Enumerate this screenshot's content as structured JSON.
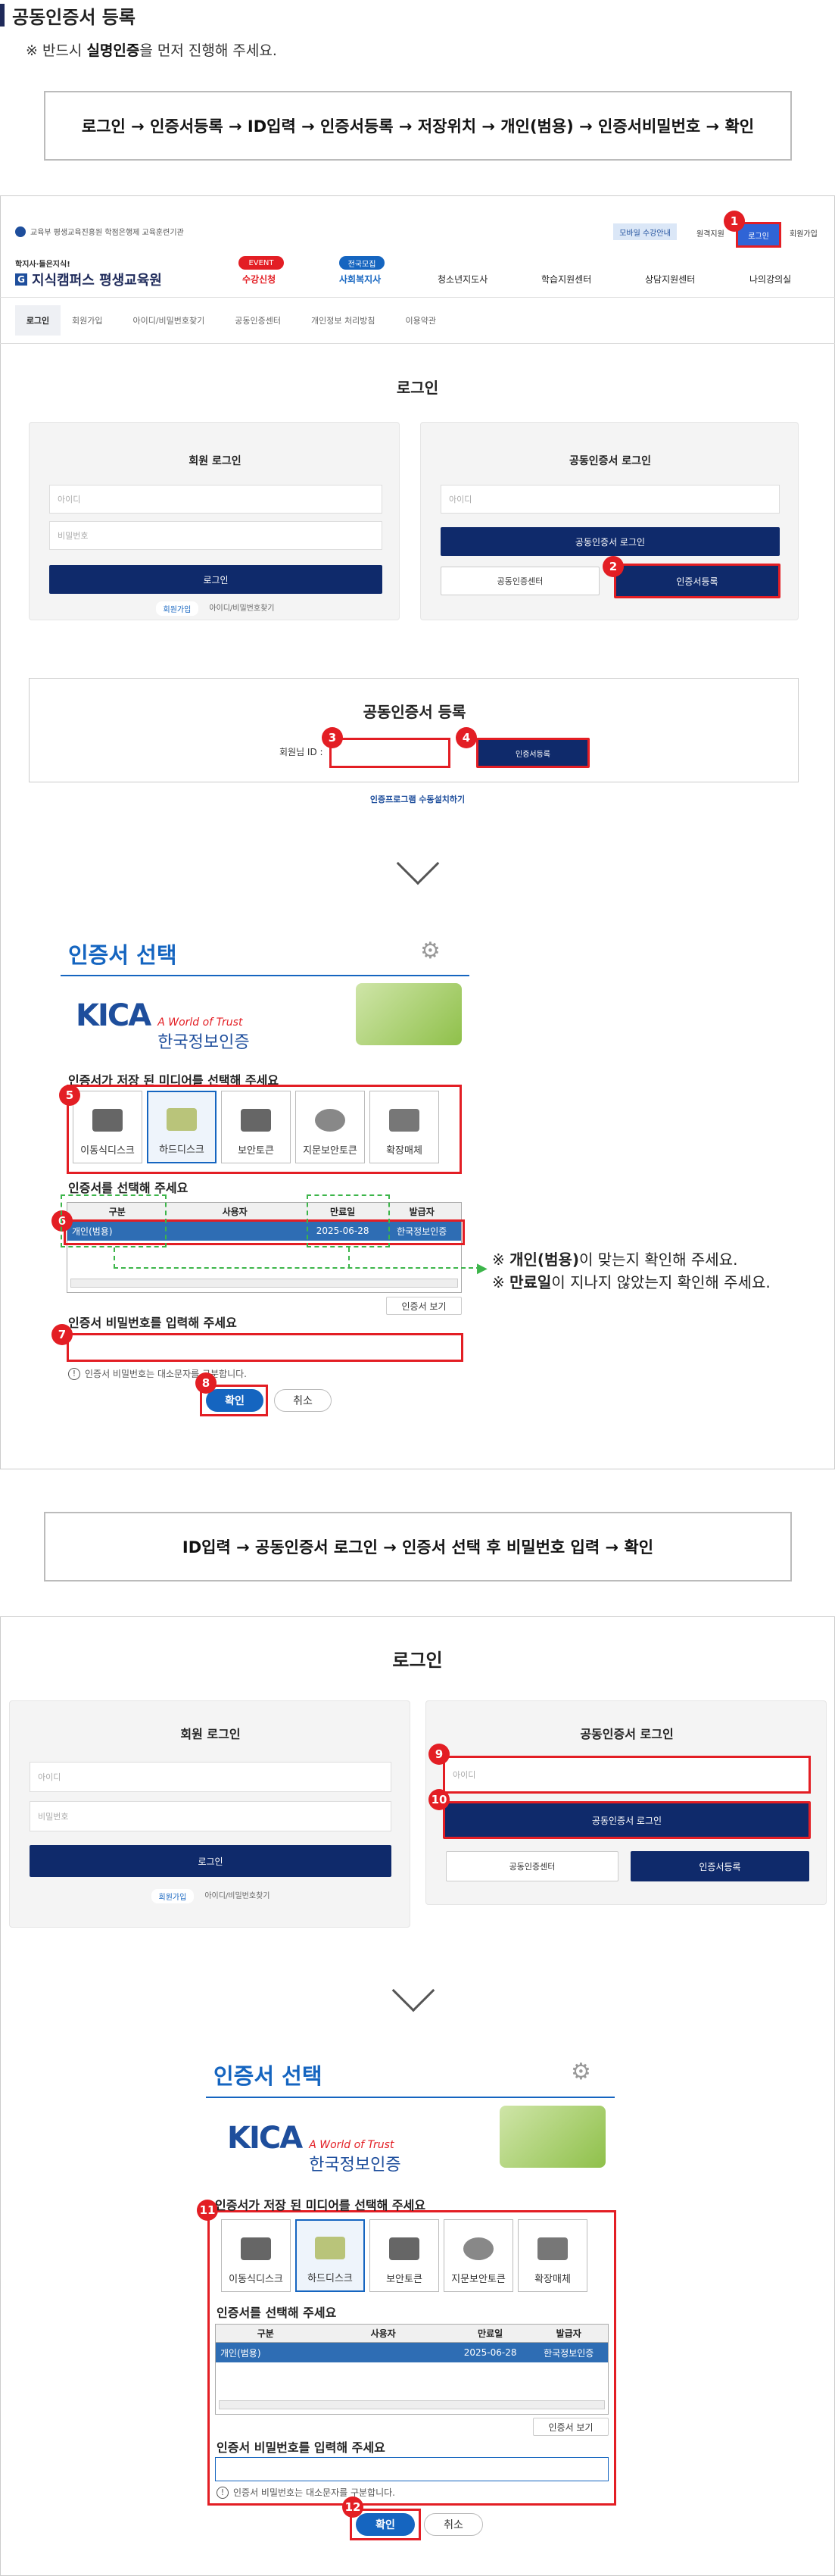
{
  "title": "공동인증서 등록",
  "note": {
    "prefix": "※ 반드시 ",
    "bold": "실명인증",
    "suffix": "을 먼저 진행해 주세요."
  },
  "flow1": "로그인 → 인증서등록 → ID입력 → 인증서등록 → 저장위치 → 개인(범용) → 인증서비밀번호 → 확인",
  "flow2": "ID입력 → 공동인증서 로그인 → 인증서 선택 후 비밀번호 입력 → 확인",
  "site": {
    "topbar_text": "교육부 평생교육진흥원 학점은행제 교육훈련기관",
    "top_links": [
      "모바일 수강안내",
      "원격지원",
      "로그인",
      "회원가입"
    ],
    "logo_small": "학지사·들은지식!",
    "logo_main": "지식캠퍼스 평생교육원",
    "nav": [
      {
        "tag": "EVENT",
        "label": "수강신청"
      },
      {
        "tag": "전국모집",
        "label": "사회복지사"
      },
      {
        "tag": "",
        "label": "청소년지도사"
      },
      {
        "tag": "",
        "label": "학습지원센터"
      },
      {
        "tag": "",
        "label": "상담지원센터"
      },
      {
        "tag": "",
        "label": "나의강의실"
      }
    ],
    "subnav": [
      "로그인",
      "회원가입",
      "아이디/비밀번호찾기",
      "공동인증센터",
      "개인정보 처리방침",
      "이용약관"
    ]
  },
  "login": {
    "heading": "로그인",
    "member_title": "회원 로그인",
    "id_ph": "아이디",
    "pw_ph": "비밀번호",
    "login_btn": "로그인",
    "join": "회원가입",
    "find": "아이디/비밀번호찾기",
    "cert_title": "공동인증서 로그인",
    "cert_login_btn": "공동인증서 로그인",
    "cert_center": "공동인증센터",
    "cert_register": "인증서등록"
  },
  "register": {
    "title": "공동인증서 등록",
    "member_id_label": "회원님 ID :",
    "register_btn": "인증서등록",
    "install_link": "인증프로그램 수동설치하기"
  },
  "dialog": {
    "title": "인증서 선택",
    "kica_logo": "KICA",
    "kica_tagline": "A World of Trust",
    "kica_name": "한국정보인증",
    "media_label": "인증서가 저장 된 미디어를 선택해 주세요",
    "media": [
      "이동식디스크",
      "하드디스크",
      "보안토큰",
      "지문보안토큰",
      "확장매체"
    ],
    "cert_label": "인증서를 선택해 주세요",
    "cols": [
      "구분",
      "사용자",
      "만료일",
      "발급자"
    ],
    "row": {
      "type": "개인(범용)",
      "user": "",
      "expiry": "2025-06-28",
      "issuer": "한국정보인증"
    },
    "view_btn": "인증서 보기",
    "pw_label": "인증서 비밀번호를 입력해 주세요",
    "pw_hint": "인증서 비밀번호는 대소문자를 구분합니다.",
    "ok": "확인",
    "cancel": "취소"
  },
  "callout": {
    "line1_pre": "※ ",
    "line1_bold": "개인(범용)",
    "line1_post": "이 맞는지 확인해 주세요.",
    "line2_pre": "※ ",
    "line2_bold": "만료일",
    "line2_post": "이 지나지 않았는지 확인해 주세요."
  },
  "badges": [
    "1",
    "2",
    "3",
    "4",
    "5",
    "6",
    "7",
    "8",
    "9",
    "10",
    "11",
    "12"
  ],
  "colors": {
    "navy": "#0f2a6b",
    "red": "#e31e24",
    "blue": "#1565c0",
    "green": "#3cb54a"
  }
}
